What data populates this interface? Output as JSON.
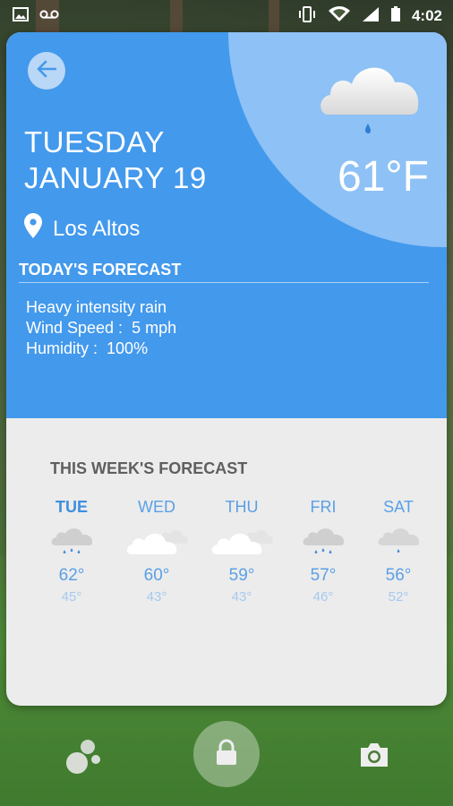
{
  "status_bar": {
    "time": "4:02",
    "icons": [
      "image-icon",
      "voicemail-icon",
      "vibrate-icon",
      "wifi-icon",
      "signal-icon",
      "battery-icon"
    ]
  },
  "colors": {
    "header_blue": "#4399ec",
    "arc_light_blue": "#8ec1f5",
    "day_blue": "#5aa0e6",
    "low_temp_blue": "#a6c9ee",
    "card_bg": "#ececec"
  },
  "today": {
    "day": "TUESDAY",
    "date": "JANUARY 19",
    "location": "Los Altos",
    "temperature": "61°F",
    "condition_icon": "rain-cloud-icon",
    "forecast_title": "TODAY'S FORECAST",
    "description": "Heavy intensity rain",
    "wind_label": "Wind Speed :",
    "wind_value": "5 mph",
    "humidity_label": "Humidity :",
    "humidity_value": "100%"
  },
  "week": {
    "title": "THIS WEEK'S FORECAST",
    "days": [
      {
        "name": "TUE",
        "high": "62°",
        "low": "45°",
        "icon": "rain-cloud-icon",
        "active": true
      },
      {
        "name": "WED",
        "high": "60°",
        "low": "43°",
        "icon": "cloud-icon",
        "active": false
      },
      {
        "name": "THU",
        "high": "59°",
        "low": "43°",
        "icon": "cloud-icon",
        "active": false
      },
      {
        "name": "FRI",
        "high": "57°",
        "low": "46°",
        "icon": "rain-cloud-icon",
        "active": false
      },
      {
        "name": "SAT",
        "high": "56°",
        "low": "52°",
        "icon": "drizzle-cloud-icon",
        "active": false
      }
    ]
  },
  "bottom_bar": {
    "left_icon": "bubbles-icon",
    "center_icon": "lock-icon",
    "right_icon": "camera-icon"
  }
}
